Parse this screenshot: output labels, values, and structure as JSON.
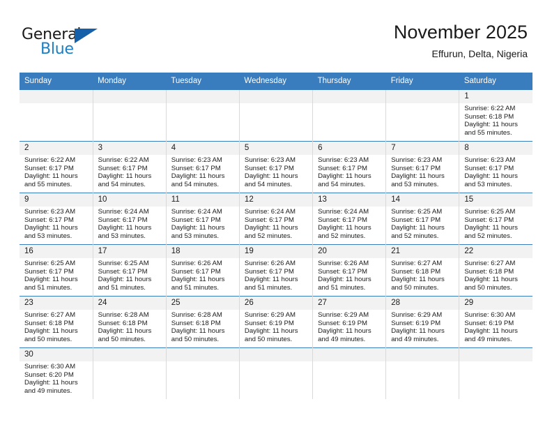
{
  "brand": {
    "word1": "General",
    "word2": "Blue",
    "flag_icon": "blue-triangle-flag-icon",
    "accent_dark": "#1560a8",
    "accent_blue": "#1c7fc4"
  },
  "header": {
    "title": "November 2025",
    "location": "Effurun, Delta, Nigeria"
  },
  "theme": {
    "header_bg": "#3a7dbf",
    "daynum_bg": "#f2f2f2",
    "grid_line": "#d9d9d9"
  },
  "weekdays": [
    "Sunday",
    "Monday",
    "Tuesday",
    "Wednesday",
    "Thursday",
    "Friday",
    "Saturday"
  ],
  "weeks": [
    [
      {
        "day": "",
        "empty": true
      },
      {
        "day": "",
        "empty": true
      },
      {
        "day": "",
        "empty": true
      },
      {
        "day": "",
        "empty": true
      },
      {
        "day": "",
        "empty": true
      },
      {
        "day": "",
        "empty": true
      },
      {
        "day": "1",
        "sunrise": "Sunrise: 6:22 AM",
        "sunset": "Sunset: 6:18 PM",
        "daylight": "Daylight: 11 hours and 55 minutes."
      }
    ],
    [
      {
        "day": "2",
        "sunrise": "Sunrise: 6:22 AM",
        "sunset": "Sunset: 6:17 PM",
        "daylight": "Daylight: 11 hours and 55 minutes."
      },
      {
        "day": "3",
        "sunrise": "Sunrise: 6:22 AM",
        "sunset": "Sunset: 6:17 PM",
        "daylight": "Daylight: 11 hours and 54 minutes."
      },
      {
        "day": "4",
        "sunrise": "Sunrise: 6:23 AM",
        "sunset": "Sunset: 6:17 PM",
        "daylight": "Daylight: 11 hours and 54 minutes."
      },
      {
        "day": "5",
        "sunrise": "Sunrise: 6:23 AM",
        "sunset": "Sunset: 6:17 PM",
        "daylight": "Daylight: 11 hours and 54 minutes."
      },
      {
        "day": "6",
        "sunrise": "Sunrise: 6:23 AM",
        "sunset": "Sunset: 6:17 PM",
        "daylight": "Daylight: 11 hours and 54 minutes."
      },
      {
        "day": "7",
        "sunrise": "Sunrise: 6:23 AM",
        "sunset": "Sunset: 6:17 PM",
        "daylight": "Daylight: 11 hours and 53 minutes."
      },
      {
        "day": "8",
        "sunrise": "Sunrise: 6:23 AM",
        "sunset": "Sunset: 6:17 PM",
        "daylight": "Daylight: 11 hours and 53 minutes."
      }
    ],
    [
      {
        "day": "9",
        "sunrise": "Sunrise: 6:23 AM",
        "sunset": "Sunset: 6:17 PM",
        "daylight": "Daylight: 11 hours and 53 minutes."
      },
      {
        "day": "10",
        "sunrise": "Sunrise: 6:24 AM",
        "sunset": "Sunset: 6:17 PM",
        "daylight": "Daylight: 11 hours and 53 minutes."
      },
      {
        "day": "11",
        "sunrise": "Sunrise: 6:24 AM",
        "sunset": "Sunset: 6:17 PM",
        "daylight": "Daylight: 11 hours and 53 minutes."
      },
      {
        "day": "12",
        "sunrise": "Sunrise: 6:24 AM",
        "sunset": "Sunset: 6:17 PM",
        "daylight": "Daylight: 11 hours and 52 minutes."
      },
      {
        "day": "13",
        "sunrise": "Sunrise: 6:24 AM",
        "sunset": "Sunset: 6:17 PM",
        "daylight": "Daylight: 11 hours and 52 minutes."
      },
      {
        "day": "14",
        "sunrise": "Sunrise: 6:25 AM",
        "sunset": "Sunset: 6:17 PM",
        "daylight": "Daylight: 11 hours and 52 minutes."
      },
      {
        "day": "15",
        "sunrise": "Sunrise: 6:25 AM",
        "sunset": "Sunset: 6:17 PM",
        "daylight": "Daylight: 11 hours and 52 minutes."
      }
    ],
    [
      {
        "day": "16",
        "sunrise": "Sunrise: 6:25 AM",
        "sunset": "Sunset: 6:17 PM",
        "daylight": "Daylight: 11 hours and 51 minutes."
      },
      {
        "day": "17",
        "sunrise": "Sunrise: 6:25 AM",
        "sunset": "Sunset: 6:17 PM",
        "daylight": "Daylight: 11 hours and 51 minutes."
      },
      {
        "day": "18",
        "sunrise": "Sunrise: 6:26 AM",
        "sunset": "Sunset: 6:17 PM",
        "daylight": "Daylight: 11 hours and 51 minutes."
      },
      {
        "day": "19",
        "sunrise": "Sunrise: 6:26 AM",
        "sunset": "Sunset: 6:17 PM",
        "daylight": "Daylight: 11 hours and 51 minutes."
      },
      {
        "day": "20",
        "sunrise": "Sunrise: 6:26 AM",
        "sunset": "Sunset: 6:17 PM",
        "daylight": "Daylight: 11 hours and 51 minutes."
      },
      {
        "day": "21",
        "sunrise": "Sunrise: 6:27 AM",
        "sunset": "Sunset: 6:18 PM",
        "daylight": "Daylight: 11 hours and 50 minutes."
      },
      {
        "day": "22",
        "sunrise": "Sunrise: 6:27 AM",
        "sunset": "Sunset: 6:18 PM",
        "daylight": "Daylight: 11 hours and 50 minutes."
      }
    ],
    [
      {
        "day": "23",
        "sunrise": "Sunrise: 6:27 AM",
        "sunset": "Sunset: 6:18 PM",
        "daylight": "Daylight: 11 hours and 50 minutes."
      },
      {
        "day": "24",
        "sunrise": "Sunrise: 6:28 AM",
        "sunset": "Sunset: 6:18 PM",
        "daylight": "Daylight: 11 hours and 50 minutes."
      },
      {
        "day": "25",
        "sunrise": "Sunrise: 6:28 AM",
        "sunset": "Sunset: 6:18 PM",
        "daylight": "Daylight: 11 hours and 50 minutes."
      },
      {
        "day": "26",
        "sunrise": "Sunrise: 6:29 AM",
        "sunset": "Sunset: 6:19 PM",
        "daylight": "Daylight: 11 hours and 50 minutes."
      },
      {
        "day": "27",
        "sunrise": "Sunrise: 6:29 AM",
        "sunset": "Sunset: 6:19 PM",
        "daylight": "Daylight: 11 hours and 49 minutes."
      },
      {
        "day": "28",
        "sunrise": "Sunrise: 6:29 AM",
        "sunset": "Sunset: 6:19 PM",
        "daylight": "Daylight: 11 hours and 49 minutes."
      },
      {
        "day": "29",
        "sunrise": "Sunrise: 6:30 AM",
        "sunset": "Sunset: 6:19 PM",
        "daylight": "Daylight: 11 hours and 49 minutes."
      }
    ],
    [
      {
        "day": "30",
        "sunrise": "Sunrise: 6:30 AM",
        "sunset": "Sunset: 6:20 PM",
        "daylight": "Daylight: 11 hours and 49 minutes."
      },
      {
        "day": "",
        "empty": true
      },
      {
        "day": "",
        "empty": true
      },
      {
        "day": "",
        "empty": true
      },
      {
        "day": "",
        "empty": true
      },
      {
        "day": "",
        "empty": true
      },
      {
        "day": "",
        "empty": true
      }
    ]
  ]
}
